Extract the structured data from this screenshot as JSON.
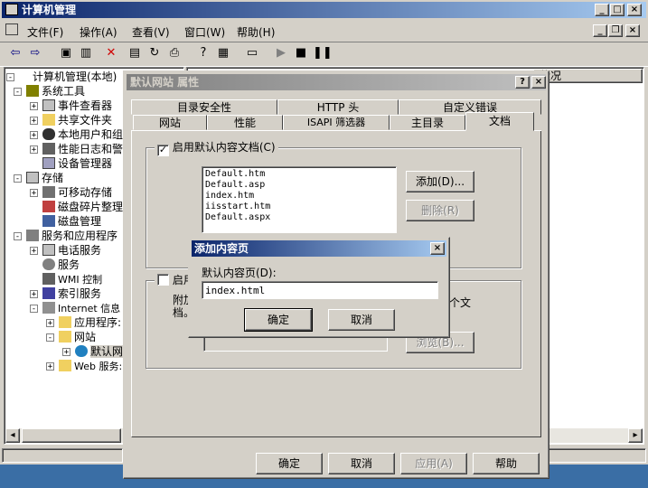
{
  "main_window": {
    "title": "计算机管理",
    "menu": [
      "文件(F)",
      "操作(A)",
      "查看(V)",
      "窗口(W)",
      "帮助(H)"
    ]
  },
  "tree": {
    "items": [
      {
        "label": "计算机管理(本地)"
      },
      {
        "label": "系统工具"
      },
      {
        "label": "事件查看器"
      },
      {
        "label": "共享文件夹"
      },
      {
        "label": "本地用户和组"
      },
      {
        "label": "性能日志和警"
      },
      {
        "label": "设备管理器"
      },
      {
        "label": "存储"
      },
      {
        "label": "可移动存储"
      },
      {
        "label": "磁盘碎片整理"
      },
      {
        "label": "磁盘管理"
      },
      {
        "label": "服务和应用程序"
      },
      {
        "label": "电话服务"
      },
      {
        "label": "服务"
      },
      {
        "label": "WMI 控制"
      },
      {
        "label": "索引服务"
      },
      {
        "label": "Internet 信息"
      },
      {
        "label": "应用程序:"
      },
      {
        "label": "网站"
      },
      {
        "label": "默认网"
      },
      {
        "label": "Web 服务:"
      }
    ]
  },
  "right_pane": {
    "header_partial": "状况"
  },
  "properties_dialog": {
    "title": "默认网站 属性",
    "tabs_back": [
      "目录安全性",
      "HTTP 头",
      "自定义错误"
    ],
    "tabs_front": [
      "网站",
      "性能",
      "ISAPI 筛选器",
      "主目录",
      "文档"
    ],
    "enable_default_doc": {
      "label": "启用默认内容文档(C)",
      "checked": true
    },
    "default_docs": [
      "Default.htm",
      "Default.asp",
      "index.htm",
      "iisstart.htm",
      "Default.aspx"
    ],
    "add_button": "添加(D)...",
    "remove_button": "删除(R)",
    "footer_check_label_partial": "启用",
    "footer_text_left": "附加",
    "footer_text_left2": "档。",
    "footer_text_right": "个文",
    "browse_button": "浏览(B)...",
    "ok": "确定",
    "cancel": "取消",
    "apply": "应用(A)",
    "help": "帮助"
  },
  "add_content_dialog": {
    "title": "添加内容页",
    "label": "默认内容页(D):",
    "value": "index.html",
    "ok": "确定",
    "cancel": "取消"
  }
}
